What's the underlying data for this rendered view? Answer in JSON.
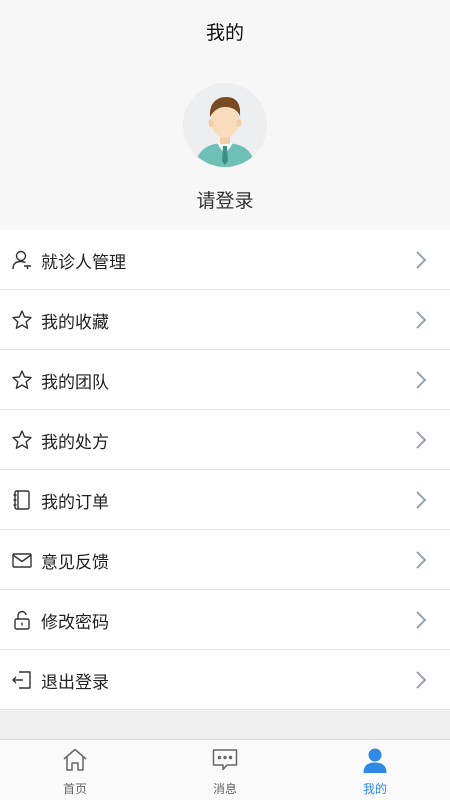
{
  "header": {
    "title": "我的"
  },
  "profile": {
    "login_label": "请登录"
  },
  "menu": {
    "items": [
      {
        "label": "就诊人管理",
        "icon": "patient-icon"
      },
      {
        "label": "我的收藏",
        "icon": "star-icon"
      },
      {
        "label": "我的团队",
        "icon": "star-icon"
      },
      {
        "label": "我的处方",
        "icon": "star-icon"
      },
      {
        "label": "我的订单",
        "icon": "notebook-icon"
      },
      {
        "label": "意见反馈",
        "icon": "mail-icon"
      },
      {
        "label": "修改密码",
        "icon": "lock-icon"
      },
      {
        "label": "退出登录",
        "icon": "logout-icon"
      }
    ]
  },
  "tabbar": {
    "tabs": [
      {
        "label": "首页",
        "icon": "home-icon",
        "active": false
      },
      {
        "label": "消息",
        "icon": "message-icon",
        "active": false
      },
      {
        "label": "我的",
        "icon": "user-icon",
        "active": true
      }
    ],
    "active_color": "#2f8ae5"
  }
}
